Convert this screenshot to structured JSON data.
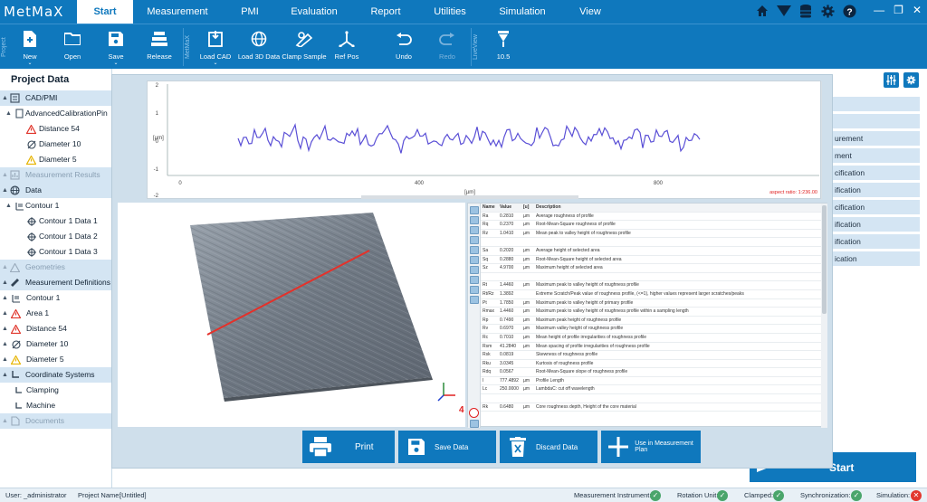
{
  "app": {
    "logo_text": "MetMaX"
  },
  "menu": [
    {
      "label": "Start",
      "active": true
    },
    {
      "label": "Measurement"
    },
    {
      "label": "PMI"
    },
    {
      "label": "Evaluation"
    },
    {
      "label": "Report"
    },
    {
      "label": "Utilities"
    },
    {
      "label": "Simulation"
    },
    {
      "label": "View"
    }
  ],
  "system_icons": [
    "home-icon",
    "funnel-icon",
    "database-icon",
    "gear-icon",
    "help-icon"
  ],
  "ribbon": {
    "group_project": "Project",
    "group_metmax": "MetMaX",
    "group_liveview": "LiveView",
    "buttons": {
      "new": "New",
      "open": "Open",
      "save": "Save",
      "release": "Release",
      "load_cad": "Load CAD",
      "load_3d": "Load 3D Data",
      "clamp_sample": "Clamp Sample",
      "ref_pos": "Ref Pos",
      "undo": "Undo",
      "redo": "Redo",
      "liveview_value": "10.5"
    }
  },
  "project_data": {
    "title": "Project Data",
    "rows": {
      "cad_pmi": "CAD/PMI",
      "adv_cal": "AdvancedCalibrationPin",
      "dist54": "Distance 54",
      "dia10": "Diameter 10",
      "dia5": "Diameter 5",
      "meas_results": "Measurement Results",
      "data": "Data",
      "contour1": "Contour 1",
      "contour1_d1": "Contour 1 Data 1",
      "contour1_d2": "Contour 1 Data 2",
      "contour1_d3": "Contour 1 Data 3",
      "geometries": "Geometries",
      "meas_defs": "Measurement Definitions",
      "md_contour1": "Contour 1",
      "md_area1": "Area 1",
      "md_dist54": "Distance 54",
      "md_dia10": "Diameter 10",
      "md_dia5": "Diameter 5",
      "coord_sys": "Coordinate Systems",
      "clamping": "Clamping",
      "machine": "Machine",
      "documents": "Documents"
    }
  },
  "right_panel": {
    "items": [
      "",
      "",
      "urement",
      "ment",
      "cification",
      "ification",
      "cification",
      "ification",
      "ification",
      "ication"
    ],
    "start_label": "Start"
  },
  "profile_graph": {
    "y_unit": "[µm]",
    "x_unit": "[µm]",
    "y_ticks": [
      "2",
      "1",
      "0",
      "-1",
      "-2"
    ],
    "x_ticks": [
      "0",
      "400",
      "800"
    ],
    "aspect_label": "aspect ratio: 1:236.00",
    "accent": "#5a4fd6"
  },
  "roughness_table": {
    "headers": {
      "name": "Name",
      "value": "Value",
      "unit": "[u]",
      "desc": "Description"
    },
    "rows": [
      [
        "Ra",
        "0.2810",
        "µm",
        "Average roughness of profile"
      ],
      [
        "Rq",
        "0.2370",
        "µm",
        "Root-Mean-Square roughness of profile"
      ],
      [
        "Rz",
        "1.0410",
        "µm",
        "Mean peak to valley height of roughness profile"
      ],
      [
        "",
        "",
        "",
        ""
      ],
      [
        "Sa",
        "0.2020",
        "µm",
        "Average height of selected area"
      ],
      [
        "Sq",
        "0.2880",
        "µm",
        "Root-Mean-Square height of selected area"
      ],
      [
        "Sz",
        "4.9700",
        "µm",
        "Maximum height of selected area"
      ],
      [
        "",
        "",
        "",
        ""
      ],
      [
        "Rt",
        "1.4460",
        "µm",
        "Maximum peak to valley height of roughness profile"
      ],
      [
        "Rt/Rz",
        "1.3892",
        "",
        "Extreme Scratch/Peak value of roughness profile, (<=1), higher values represent larger scratches/peaks"
      ],
      [
        "Pt",
        "1.7850",
        "µm",
        "Maximum peak to valley height of primary profile"
      ],
      [
        "Rmax",
        "1.4460",
        "µm",
        "Maximum peak to valley height of roughness profile within a sampling length"
      ],
      [
        "Rp",
        "0.7490",
        "µm",
        "Maximum peak height of roughness profile"
      ],
      [
        "Rv",
        "0.6970",
        "µm",
        "Maximum valley height of roughness profile"
      ],
      [
        "Rc",
        "0.7010",
        "µm",
        "Mean height of profile irregularities of roughness profile"
      ],
      [
        "Rsm",
        "41.2840",
        "µm",
        "Mean spacing of profile irregularities of roughness profile"
      ],
      [
        "Rsk",
        "0.0819",
        "",
        "Skewness of roughness profile"
      ],
      [
        "Rku",
        "3.0345",
        "",
        "Kurtosis of roughness profile"
      ],
      [
        "Rdq",
        "0.0567",
        "",
        "Root-Mean-Square slope of roughness profile"
      ],
      [
        "l",
        "777.4892",
        "µm",
        "Profile Length"
      ],
      [
        "Lc",
        "250.0000",
        "µm",
        "LambdaC: cut off wavelength"
      ],
      [
        "",
        "",
        "",
        ""
      ],
      [
        "Rk",
        "0.6480",
        "µm",
        "Core roughness depth, Height of the core material"
      ]
    ]
  },
  "annotation": {
    "number": "4"
  },
  "dialog_buttons": {
    "print": "Print",
    "save_data": "Save Data",
    "discard_data": "Discard Data",
    "use_in_plan": "Use in Measurement Plan"
  },
  "status": {
    "user_label": "User:",
    "user_value": "_administrator",
    "project_label": "Project Name:",
    "project_value": "[Untitled]",
    "instrument": "Measurement Instrument:",
    "rotation": "Rotation Unit:",
    "clamped": "Clamped:",
    "sync": "Synchronization:",
    "simulation": "Simulation:"
  }
}
